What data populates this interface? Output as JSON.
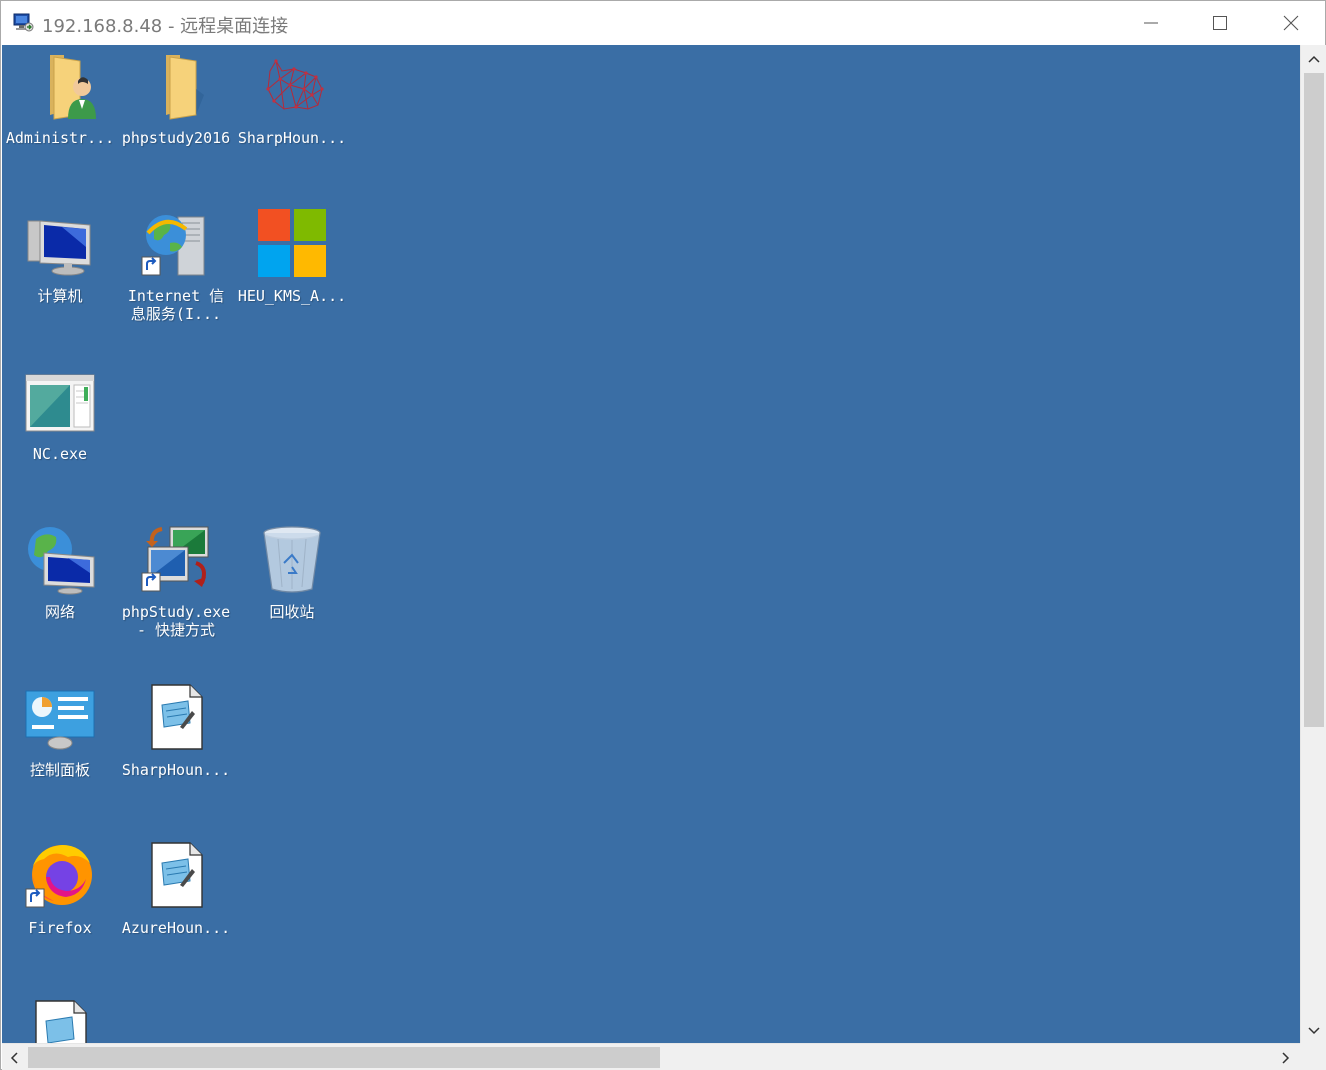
{
  "window": {
    "title": "192.168.8.48 - 远程桌面连接",
    "minimize_icon": "minimize-icon",
    "maximize_icon": "maximize-icon",
    "close_icon": "close-icon"
  },
  "colors": {
    "desktop_background": "#3a6ea5",
    "scrollbar_track": "#f0f0f0",
    "scrollbar_thumb": "#cdcdcd"
  },
  "desktop": {
    "icons": [
      {
        "label": "Administr...",
        "icon": "user-folder-icon"
      },
      {
        "label": "phpstudy2016",
        "icon": "folder-icon"
      },
      {
        "label": "SharpHoun...",
        "icon": "bloodhound-icon"
      },
      {
        "label": "计算机",
        "icon": "computer-icon"
      },
      {
        "label": "Internet 信\n息服务(I...",
        "icon": "iis-manager-icon"
      },
      {
        "label": "HEU_KMS_A...",
        "icon": "windows-logo-icon"
      },
      {
        "label": "NC.exe",
        "icon": "application-window-icon"
      },
      {
        "label": "网络",
        "icon": "network-icon"
      },
      {
        "label": "phpStudy.exe\n- 快捷方式",
        "icon": "phpstudy-icon"
      },
      {
        "label": "回收站",
        "icon": "recycle-bin-icon"
      },
      {
        "label": "控制面板",
        "icon": "control-panel-icon"
      },
      {
        "label": "SharpHoun...",
        "icon": "text-document-icon"
      },
      {
        "label": "Firefox",
        "icon": "firefox-icon"
      },
      {
        "label": "AzureHoun...",
        "icon": "text-document-icon"
      },
      {
        "label": "",
        "icon": "text-document-icon"
      }
    ]
  },
  "scrollbars": {
    "vertical": {
      "up_icon": "chevron-up-icon",
      "down_icon": "chevron-down-icon"
    },
    "horizontal": {
      "left_icon": "chevron-left-icon",
      "right_icon": "chevron-right-icon"
    }
  }
}
